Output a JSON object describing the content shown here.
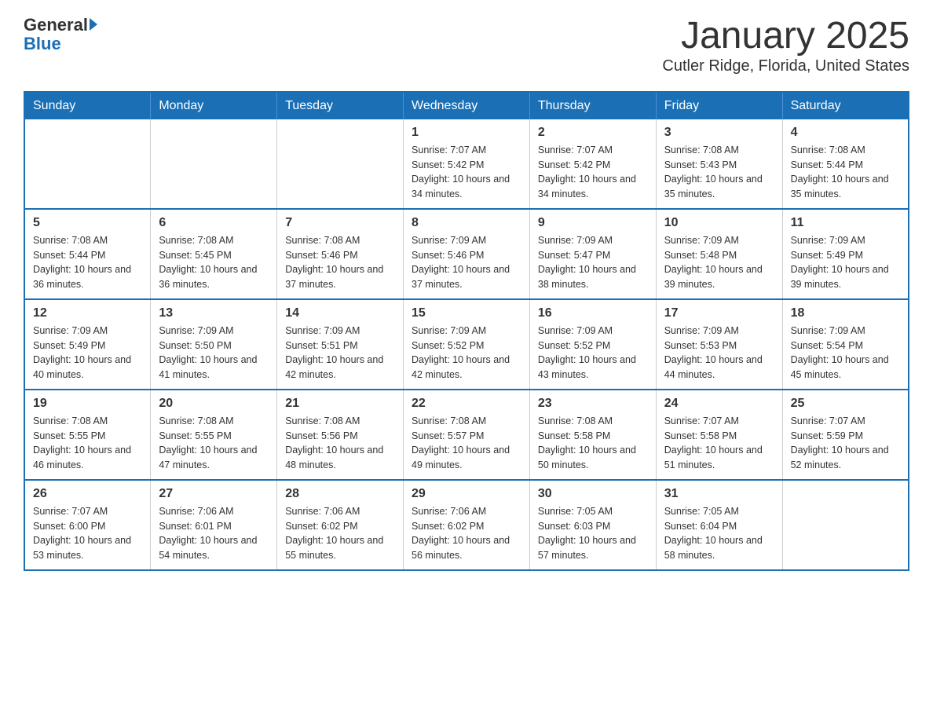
{
  "logo": {
    "general": "General",
    "blue": "Blue",
    "arrow_symbol": "▶"
  },
  "title": "January 2025",
  "subtitle": "Cutler Ridge, Florida, United States",
  "days_of_week": [
    "Sunday",
    "Monday",
    "Tuesday",
    "Wednesday",
    "Thursday",
    "Friday",
    "Saturday"
  ],
  "weeks": [
    [
      {
        "day": "",
        "info": ""
      },
      {
        "day": "",
        "info": ""
      },
      {
        "day": "",
        "info": ""
      },
      {
        "day": "1",
        "info": "Sunrise: 7:07 AM\nSunset: 5:42 PM\nDaylight: 10 hours and 34 minutes."
      },
      {
        "day": "2",
        "info": "Sunrise: 7:07 AM\nSunset: 5:42 PM\nDaylight: 10 hours and 34 minutes."
      },
      {
        "day": "3",
        "info": "Sunrise: 7:08 AM\nSunset: 5:43 PM\nDaylight: 10 hours and 35 minutes."
      },
      {
        "day": "4",
        "info": "Sunrise: 7:08 AM\nSunset: 5:44 PM\nDaylight: 10 hours and 35 minutes."
      }
    ],
    [
      {
        "day": "5",
        "info": "Sunrise: 7:08 AM\nSunset: 5:44 PM\nDaylight: 10 hours and 36 minutes."
      },
      {
        "day": "6",
        "info": "Sunrise: 7:08 AM\nSunset: 5:45 PM\nDaylight: 10 hours and 36 minutes."
      },
      {
        "day": "7",
        "info": "Sunrise: 7:08 AM\nSunset: 5:46 PM\nDaylight: 10 hours and 37 minutes."
      },
      {
        "day": "8",
        "info": "Sunrise: 7:09 AM\nSunset: 5:46 PM\nDaylight: 10 hours and 37 minutes."
      },
      {
        "day": "9",
        "info": "Sunrise: 7:09 AM\nSunset: 5:47 PM\nDaylight: 10 hours and 38 minutes."
      },
      {
        "day": "10",
        "info": "Sunrise: 7:09 AM\nSunset: 5:48 PM\nDaylight: 10 hours and 39 minutes."
      },
      {
        "day": "11",
        "info": "Sunrise: 7:09 AM\nSunset: 5:49 PM\nDaylight: 10 hours and 39 minutes."
      }
    ],
    [
      {
        "day": "12",
        "info": "Sunrise: 7:09 AM\nSunset: 5:49 PM\nDaylight: 10 hours and 40 minutes."
      },
      {
        "day": "13",
        "info": "Sunrise: 7:09 AM\nSunset: 5:50 PM\nDaylight: 10 hours and 41 minutes."
      },
      {
        "day": "14",
        "info": "Sunrise: 7:09 AM\nSunset: 5:51 PM\nDaylight: 10 hours and 42 minutes."
      },
      {
        "day": "15",
        "info": "Sunrise: 7:09 AM\nSunset: 5:52 PM\nDaylight: 10 hours and 42 minutes."
      },
      {
        "day": "16",
        "info": "Sunrise: 7:09 AM\nSunset: 5:52 PM\nDaylight: 10 hours and 43 minutes."
      },
      {
        "day": "17",
        "info": "Sunrise: 7:09 AM\nSunset: 5:53 PM\nDaylight: 10 hours and 44 minutes."
      },
      {
        "day": "18",
        "info": "Sunrise: 7:09 AM\nSunset: 5:54 PM\nDaylight: 10 hours and 45 minutes."
      }
    ],
    [
      {
        "day": "19",
        "info": "Sunrise: 7:08 AM\nSunset: 5:55 PM\nDaylight: 10 hours and 46 minutes."
      },
      {
        "day": "20",
        "info": "Sunrise: 7:08 AM\nSunset: 5:55 PM\nDaylight: 10 hours and 47 minutes."
      },
      {
        "day": "21",
        "info": "Sunrise: 7:08 AM\nSunset: 5:56 PM\nDaylight: 10 hours and 48 minutes."
      },
      {
        "day": "22",
        "info": "Sunrise: 7:08 AM\nSunset: 5:57 PM\nDaylight: 10 hours and 49 minutes."
      },
      {
        "day": "23",
        "info": "Sunrise: 7:08 AM\nSunset: 5:58 PM\nDaylight: 10 hours and 50 minutes."
      },
      {
        "day": "24",
        "info": "Sunrise: 7:07 AM\nSunset: 5:58 PM\nDaylight: 10 hours and 51 minutes."
      },
      {
        "day": "25",
        "info": "Sunrise: 7:07 AM\nSunset: 5:59 PM\nDaylight: 10 hours and 52 minutes."
      }
    ],
    [
      {
        "day": "26",
        "info": "Sunrise: 7:07 AM\nSunset: 6:00 PM\nDaylight: 10 hours and 53 minutes."
      },
      {
        "day": "27",
        "info": "Sunrise: 7:06 AM\nSunset: 6:01 PM\nDaylight: 10 hours and 54 minutes."
      },
      {
        "day": "28",
        "info": "Sunrise: 7:06 AM\nSunset: 6:02 PM\nDaylight: 10 hours and 55 minutes."
      },
      {
        "day": "29",
        "info": "Sunrise: 7:06 AM\nSunset: 6:02 PM\nDaylight: 10 hours and 56 minutes."
      },
      {
        "day": "30",
        "info": "Sunrise: 7:05 AM\nSunset: 6:03 PM\nDaylight: 10 hours and 57 minutes."
      },
      {
        "day": "31",
        "info": "Sunrise: 7:05 AM\nSunset: 6:04 PM\nDaylight: 10 hours and 58 minutes."
      },
      {
        "day": "",
        "info": ""
      }
    ]
  ]
}
